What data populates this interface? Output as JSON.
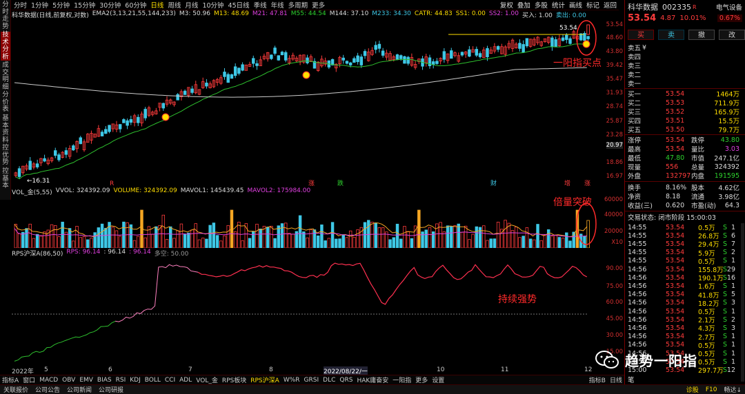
{
  "nav_tabs": [
    "分时走势",
    "技术分析",
    "成交明细",
    "分价表",
    "基本资料",
    "控优势",
    "控基本"
  ],
  "period_tabs": [
    "分时",
    "1分钟",
    "5分钟",
    "15分钟",
    "30分钟",
    "60分钟",
    "日线",
    "周线",
    "月线",
    "10分钟",
    "45日线",
    "季线",
    "年线",
    "多周期",
    "更多"
  ],
  "active_period": "日线",
  "chart_tools": [
    "复权",
    "叠加",
    "多股",
    "统计",
    "画线",
    "标记",
    "返回"
  ],
  "chart_info": {
    "name": "科华数据(日线,前复权,对数)",
    "ema_label": "EMA2(3,13,21,55,144,233)",
    "m3": "M3: 50.96",
    "m13": "M13: 48.69",
    "m21": "M21: 47.81",
    "m55": "M55: 44.54",
    "m144": "M144: 37.10",
    "m233": "M233: 34.30",
    "catr": "CATR: 44.83",
    "ss1": "SS1: 0.00",
    "ss2": "SS2: 1.00",
    "buy": "买入: 1.00",
    "sell": "卖出: 0.00"
  },
  "price_axis": [
    "53.54",
    "48.60",
    "43.80",
    "39.42",
    "35.47",
    "31.93",
    "28.74",
    "25.87",
    "23.28",
    "20.97",
    "18.86",
    "16.97"
  ],
  "price_labels": {
    "high": "53.54",
    "low": "←16.31"
  },
  "event_markers": [
    "R",
    "涨",
    "跌",
    "财",
    "增",
    "涨"
  ],
  "vol_info": {
    "label": "VOL_金(5,55)",
    "vvol": "VVOL: 324392.09",
    "volume": "VOLUME: 324392.09",
    "mavol1": "MAVOL1: 145439.45",
    "mavol2": "MAVOL2: 175984.00"
  },
  "vol_axis": [
    "60000",
    "40000",
    "20000",
    "X10"
  ],
  "rps_info": {
    "label": "RPS沪深A(86,50)",
    "rps": "RPS: 96.14",
    "v1": ": 96.14",
    "v2": ": 96.14",
    "v3": "多空: 50.00"
  },
  "rps_axis": [
    "90.00",
    "75.00",
    "60.00",
    "45.00",
    "30.00",
    "15.00"
  ],
  "date_axis": [
    "2022年",
    "5",
    "6",
    "7",
    "8",
    "2022/08/22/一",
    "10",
    "11",
    "12"
  ],
  "indicator_tabs": [
    "指标A",
    "窗口",
    "MACD",
    "OBV",
    "EMV",
    "BIAS",
    "RSI",
    "KDJ",
    "BOLL",
    "CCI",
    "ADL",
    "VOL_金",
    "RPS板块",
    "RPS沪深A",
    "W%R",
    "GRSI",
    "DLC",
    "QRS",
    "HAK庸奋安",
    "一阳指",
    "更多",
    "设置"
  ],
  "indicator_active": "RPS沪深A",
  "indicator_right": [
    "指标B",
    "日线"
  ],
  "status_tabs": [
    "关联报价",
    "公司公告",
    "公司新闻",
    "公司研报"
  ],
  "status_right": [
    "诊股",
    "F10",
    "畅达↓"
  ],
  "annotations": {
    "yiyang": "一阳指买点",
    "beiliang": "倍量突破",
    "chixu": "持续强势"
  },
  "watermark": "趋势一阳指",
  "quote": {
    "name": "科华数据",
    "code": "002335",
    "badge": "R",
    "sector": "电气设备",
    "sector_pct": "0.67%",
    "price": "53.54",
    "change": "4.87",
    "pct": "10.01%",
    "buttons": [
      "买",
      "卖",
      "撤",
      "改"
    ],
    "sell_levels": [
      {
        "label": "卖五",
        "tag": "¥",
        "price": "",
        "vol": ""
      },
      {
        "label": "卖四",
        "price": "",
        "vol": ""
      },
      {
        "label": "卖三",
        "price": "",
        "vol": ""
      },
      {
        "label": "卖二",
        "price": "",
        "vol": ""
      },
      {
        "label": "卖一",
        "price": "",
        "vol": ""
      }
    ],
    "buy_levels": [
      {
        "label": "买一",
        "price": "53.54",
        "vol": "1464万"
      },
      {
        "label": "买二",
        "price": "53.53",
        "vol": "711.9万"
      },
      {
        "label": "买三",
        "price": "53.52",
        "vol": "165.9万"
      },
      {
        "label": "买四",
        "price": "53.51",
        "vol": "15.5万"
      },
      {
        "label": "买五",
        "price": "53.50",
        "vol": "79.7万"
      }
    ],
    "stats": [
      {
        "l1": "涨停",
        "v1": "53.54",
        "l2": "跌停",
        "v2": "43.80"
      },
      {
        "l1": "最高",
        "v1": "53.54",
        "l2": "量比",
        "v2": "3.03"
      },
      {
        "l1": "最低",
        "v1": "47.80",
        "l2": "市值",
        "v2": "247.1亿"
      },
      {
        "l1": "现量",
        "v1": "556",
        "l2": "总量",
        "v2": "324392"
      },
      {
        "l1": "外盘",
        "v1": "132797",
        "l2": "内盘",
        "v2": "191595"
      }
    ],
    "stats2": [
      {
        "l1": "换手",
        "v1": "8.16%",
        "l2": "股本",
        "v2": "4.62亿"
      },
      {
        "l1": "净资",
        "v1": "8.18",
        "l2": "流通",
        "v2": "3.98亿"
      },
      {
        "l1": "收益(三)",
        "v1": "0.620",
        "l2": "市盈(动)",
        "v2": "64.3"
      }
    ],
    "trade_status": "交易状态: 闭市阶段 15:00:03",
    "ticks": [
      {
        "t": "14:55",
        "p": "53.54",
        "v": "0.5万",
        "s": "S",
        "n": "1"
      },
      {
        "t": "14:55",
        "p": "53.54",
        "v": "26.8万",
        "s": "S",
        "n": "6"
      },
      {
        "t": "14:55",
        "p": "53.54",
        "v": "29.4万",
        "s": "S",
        "n": "7"
      },
      {
        "t": "14:55",
        "p": "53.54",
        "v": "5.9万",
        "s": "S",
        "n": "2"
      },
      {
        "t": "14:55",
        "p": "53.54",
        "v": "0.5万",
        "s": "S",
        "n": "1"
      },
      {
        "t": "14:56",
        "p": "53.54",
        "v": "155.8万",
        "s": "S",
        "n": "29"
      },
      {
        "t": "14:56",
        "p": "53.54",
        "v": "190.1万",
        "s": "S",
        "n": "16"
      },
      {
        "t": "14:56",
        "p": "53.54",
        "v": "1.6万",
        "s": "S",
        "n": "1"
      },
      {
        "t": "14:56",
        "p": "53.54",
        "v": "41.8万",
        "s": "S",
        "n": "5"
      },
      {
        "t": "14:56",
        "p": "53.54",
        "v": "18.2万",
        "s": "S",
        "n": "3"
      },
      {
        "t": "14:56",
        "p": "53.54",
        "v": "0.5万",
        "s": "S",
        "n": "1"
      },
      {
        "t": "14:56",
        "p": "53.54",
        "v": "2.1万",
        "s": "S",
        "n": "2"
      },
      {
        "t": "14:56",
        "p": "53.54",
        "v": "4.3万",
        "s": "S",
        "n": "3"
      },
      {
        "t": "14:56",
        "p": "53.54",
        "v": "2.7万",
        "s": "S",
        "n": "1"
      },
      {
        "t": "14:56",
        "p": "53.54",
        "v": "0.5万",
        "s": "S",
        "n": "1"
      },
      {
        "t": "14:56",
        "p": "53.54",
        "v": "0.5万",
        "s": "S",
        "n": "1"
      },
      {
        "t": "14:56",
        "p": "53.54",
        "v": "0.5万",
        "s": "S",
        "n": "1"
      },
      {
        "t": "15:00",
        "p": "53.54",
        "v": "297.7万",
        "s": "S",
        "n": "12"
      }
    ],
    "footer_label": "笔"
  },
  "colors": {
    "up": "#ff3c3c",
    "down": "#3ec8e6",
    "ma13": "#2ec02e",
    "ma144": "#cccccc",
    "rps": "#ff3050",
    "vol_ma1": "#f5a623",
    "vol_ma2": "#e040e0"
  }
}
